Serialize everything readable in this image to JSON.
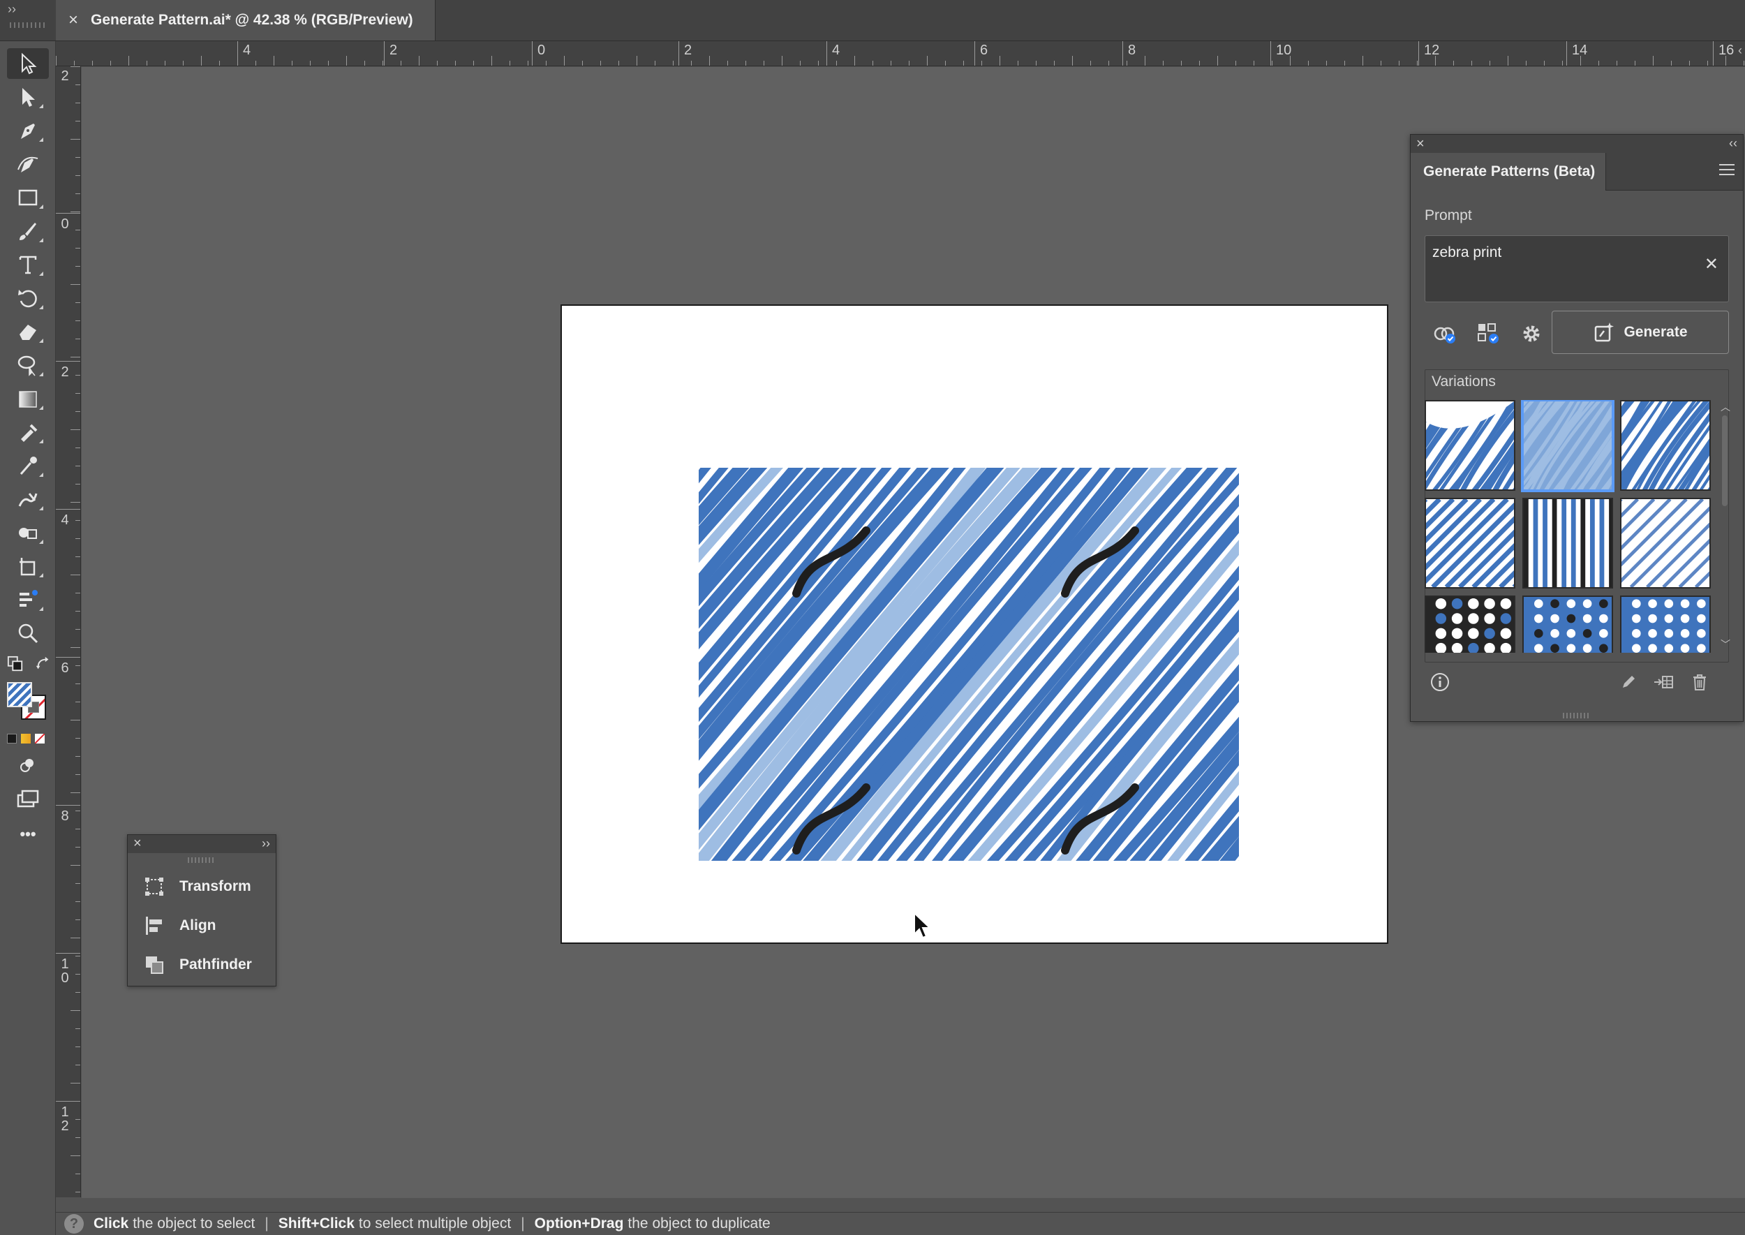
{
  "app": {
    "document_tab_title": "Generate Pattern.ai* @ 42.38 % (RGB/Preview)"
  },
  "ruler": {
    "horizontal_labels": [
      "4",
      "2",
      "0",
      "2",
      "4",
      "6",
      "8",
      "10",
      "12",
      "14",
      "16"
    ],
    "vertical_labels": [
      "2",
      "0",
      "2",
      "4",
      "6",
      "8",
      "10",
      "12"
    ]
  },
  "toolbar": {
    "tools": [
      {
        "name": "selection-tool",
        "icon": "arrow-icon",
        "active": true
      },
      {
        "name": "direct-selection-tool",
        "icon": "hollow-arrow-icon"
      },
      {
        "name": "pen-tool",
        "icon": "pen-icon"
      },
      {
        "name": "curvature-tool",
        "icon": "curvature-pen-icon"
      },
      {
        "name": "rectangle-tool",
        "icon": "rectangle-icon"
      },
      {
        "name": "paintbrush-tool",
        "icon": "brush-icon"
      },
      {
        "name": "type-tool",
        "icon": "type-icon"
      },
      {
        "name": "rotate-tool",
        "icon": "rotate-icon"
      },
      {
        "name": "eraser-tool",
        "icon": "eraser-icon"
      },
      {
        "name": "lasso-tool",
        "icon": "lasso-icon"
      },
      {
        "name": "gradient-tool",
        "icon": "gradient-icon"
      },
      {
        "name": "eyedropper-tool",
        "icon": "eyedropper-icon"
      },
      {
        "name": "measure-tool",
        "icon": "pipette-icon"
      },
      {
        "name": "puppet-warp-tool",
        "icon": "puppet-icon"
      },
      {
        "name": "shape-builder-tool",
        "icon": "shape-builder-icon"
      },
      {
        "name": "artboard-tool",
        "icon": "artboard-icon"
      },
      {
        "name": "graph-tool",
        "icon": "graph-icon"
      },
      {
        "name": "zoom-tool",
        "icon": "zoom-icon"
      }
    ],
    "more_label": "•••"
  },
  "mini_panel": {
    "items": [
      {
        "label": "Transform",
        "icon": "transform-icon"
      },
      {
        "label": "Align",
        "icon": "align-icon"
      },
      {
        "label": "Pathfinder",
        "icon": "pathfinder-icon"
      }
    ]
  },
  "generate_panel": {
    "title": "Generate Patterns (Beta)",
    "prompt_label": "Prompt",
    "prompt_value": "zebra print",
    "generate_label": "Generate",
    "variations_label": "Variations",
    "accent_color": "#5b9bf7",
    "pattern_blue": "#3f74bd",
    "pattern_light_blue": "#9ebde3",
    "variations": [
      {
        "kind": "zebra-white-bg"
      },
      {
        "kind": "zebra-light",
        "selected": true
      },
      {
        "kind": "zebra-white-bg-2"
      },
      {
        "kind": "diagonal-stripes"
      },
      {
        "kind": "vertical-stripes-dark"
      },
      {
        "kind": "diagonal-stripes-light"
      },
      {
        "kind": "polka-dark"
      },
      {
        "kind": "polka-blue-mixed"
      },
      {
        "kind": "polka-blue-white"
      }
    ]
  },
  "statusbar": {
    "hint1_bold": "Click",
    "hint1_text": "the object to select",
    "hint2_bold": "Shift+Click",
    "hint2_text": "to select multiple object",
    "hint3_bold": "Option+Drag",
    "hint3_text": "the object to duplicate",
    "separator": "|"
  }
}
